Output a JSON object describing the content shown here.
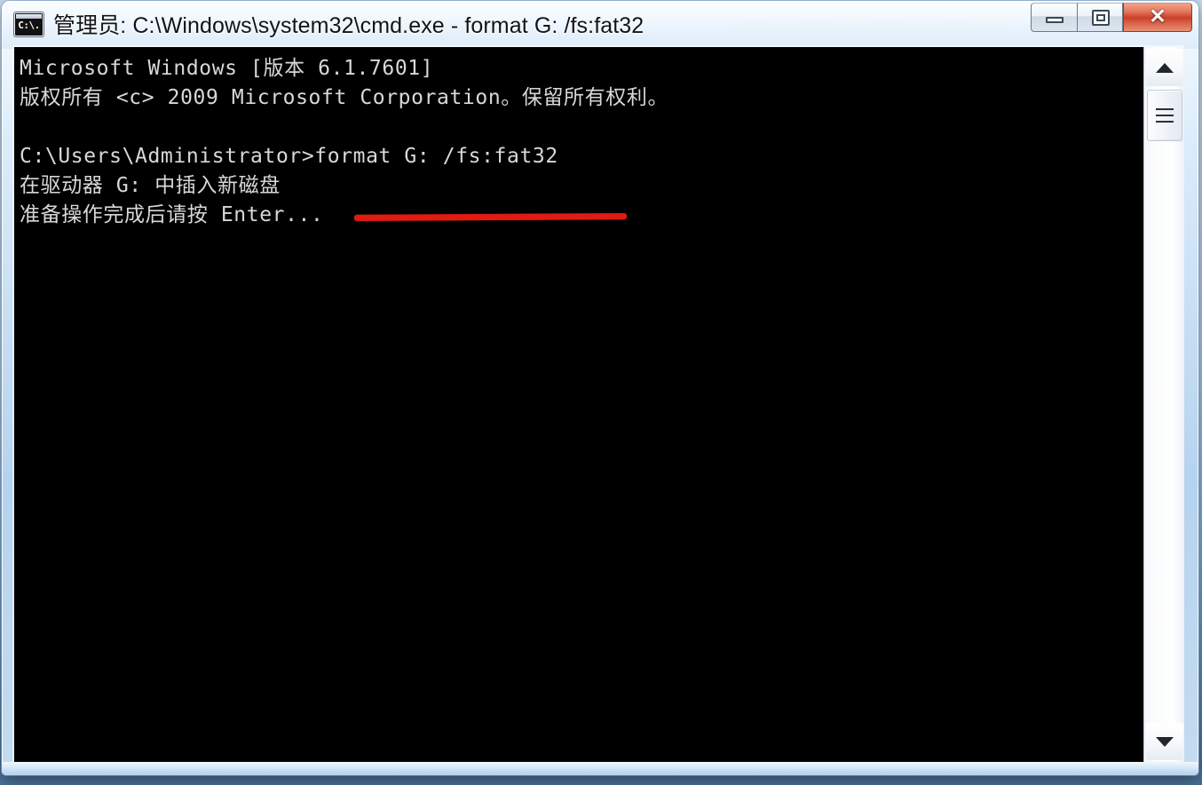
{
  "window": {
    "title": "管理员: C:\\Windows\\system32\\cmd.exe - format  G: /fs:fat32",
    "icon_glyph": "C:\\.",
    "icon_name": "cmd-console-icon",
    "controls": {
      "minimize_label": "",
      "maximize_label": "",
      "close_label": "✕"
    },
    "accent_close_color": "#c8402a",
    "glass_color": "#bcd4ec"
  },
  "console": {
    "background_color": "#000000",
    "text_color": "#d8d8d8",
    "lines": [
      "Microsoft Windows [版本 6.1.7601]",
      "版权所有 <c> 2009 Microsoft Corporation。保留所有权利。",
      "",
      "C:\\Users\\Administrator>format G: /fs:fat32",
      "在驱动器 G: 中插入新磁盘",
      "准备操作完成后请按 Enter..."
    ]
  },
  "annotation": {
    "type": "underline",
    "color": "#e01b12",
    "targets_text": "format G: /fs:fat32"
  },
  "scrollbar": {
    "up_arrow": "▲",
    "down_arrow": "▼",
    "position": "top"
  }
}
